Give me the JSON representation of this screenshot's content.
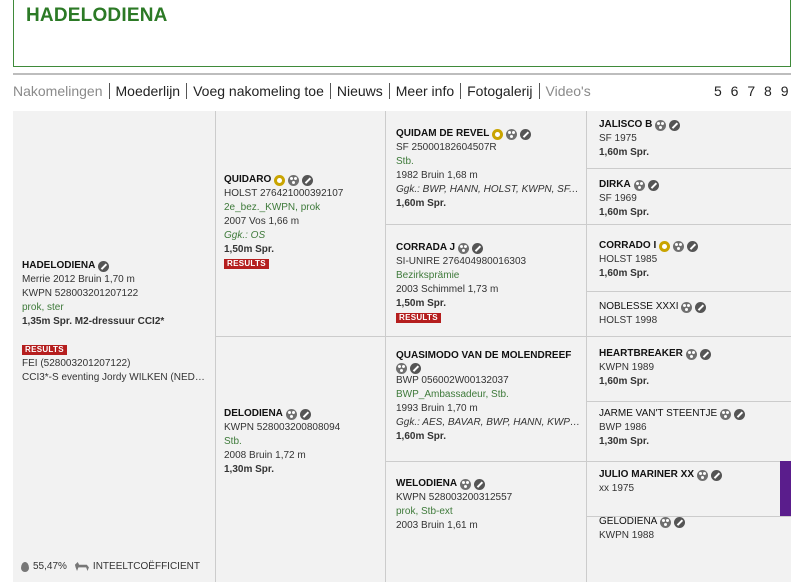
{
  "title": "HADELODIENA",
  "nav": {
    "tabs": [
      {
        "label": "Nakomelingen",
        "muted": true
      },
      {
        "label": "Moederlijn",
        "muted": false
      },
      {
        "label": "Voeg nakomeling toe",
        "muted": false
      },
      {
        "label": "Nieuws",
        "muted": false
      },
      {
        "label": "Meer info",
        "muted": false
      },
      {
        "label": "Fotogalerij",
        "muted": false
      },
      {
        "label": "Video's",
        "muted": true
      }
    ],
    "pages": "5 6 7 8 9"
  },
  "subject": {
    "name": "HADELODIENA",
    "line1": "Merrie 2012 Bruin 1,70 m",
    "line2": "KWPN 528003201207122",
    "line3": "prok, ster",
    "line4": "1,35m Spr. M2-dressuur CCI2*",
    "results_label": "RESULTS",
    "fei": "FEI (528003201207122)",
    "event": "CCI3*-S eventing Jordy WILKEN (NED), 2..."
  },
  "sire": {
    "name": "QUIDARO",
    "reg": "HOLST 276421000392107",
    "pred": "2e_bez._KWPN, prok",
    "info": "2007 Vos 1,66 m",
    "ggk": "Ggk.: OS",
    "sport": "1,50m Spr.",
    "results_label": "RESULTS"
  },
  "dam": {
    "name": "DELODIENA",
    "reg": "KWPN 528003200808094",
    "pred": "Stb.",
    "info": "2008 Bruin 1,72 m",
    "sport": "1,30m Spr."
  },
  "gp": [
    {
      "name": "QUIDAM DE REVEL",
      "reg": "SF 25000182604507R",
      "pred": "Stb.",
      "info": "1982 Bruin 1,68 m",
      "ggk": "Ggk.: BWP, HANN, HOLST, KWPN, SF, SI-U...",
      "sport": "1,60m Spr."
    },
    {
      "name": "CORRADA J",
      "reg": "SI-UNIRE 276404980016303",
      "pred": "Bezirksprämie",
      "info": "2003 Schimmel 1,73 m",
      "sport": "1,50m Spr.",
      "results_label": "RESULTS"
    },
    {
      "name": "QUASIMODO VAN DE MOLENDREEF",
      "reg": "BWP 056002W00132037",
      "pred": "BWP_Ambassadeur, Stb.",
      "info": "1993 Bruin 1,70 m",
      "ggk": "Ggk.: AES, BAVAR, BWP, HANN, KWPN, OS, ...",
      "sport": "1,60m Spr."
    },
    {
      "name": "WELODIENA",
      "reg": "KWPN 528003200312557",
      "pred": "prok, Stb-ext",
      "info": "2003 Bruin 1,61 m"
    }
  ],
  "ggp": [
    {
      "name": "JALISCO B",
      "reg": "SF 1975",
      "sport": "1,60m Spr."
    },
    {
      "name": "DIRKA",
      "reg": "SF 1969",
      "sport": "1,60m Spr."
    },
    {
      "name": "CORRADO I",
      "reg": "HOLST 1985",
      "sport": "1,60m Spr."
    },
    {
      "name": "NOBLESSE XXXI",
      "reg": "HOLST 1998"
    },
    {
      "name": "HEARTBREAKER",
      "reg": "KWPN 1989",
      "sport": "1,60m Spr."
    },
    {
      "name": "JARME VAN'T STEENTJE",
      "reg": "BWP 1986",
      "sport": "1,30m Spr."
    },
    {
      "name": "JULIO MARINER XX",
      "reg": "xx 1975"
    },
    {
      "name": "GELODIENA",
      "reg": "KWPN 1988"
    }
  ],
  "inteelt": {
    "percent": "55,47%",
    "label": "INTEELTCOËFFICIENT"
  },
  "colors": {
    "brand_green": "#2c7a26",
    "results_red": "#b51e1e",
    "highlight_purple": "#5a1d8c"
  }
}
